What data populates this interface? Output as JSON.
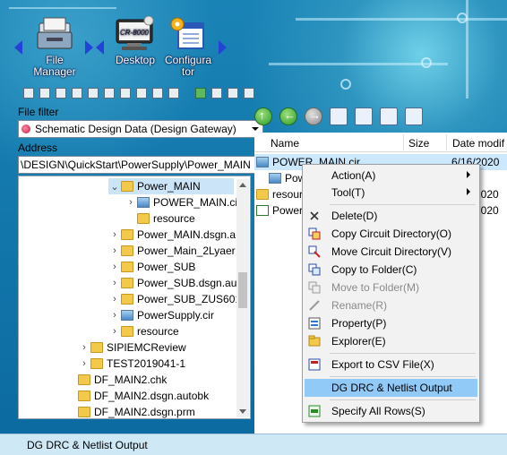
{
  "launcher": {
    "items": [
      {
        "label_line1": "File",
        "label_line2": "Manager",
        "icon": "file-manager-icon"
      },
      {
        "label_line1": "Desktop",
        "label_line2": "",
        "icon": "desktop-monitor-icon",
        "screen_text": "CR-8000"
      },
      {
        "label_line1": "Configura",
        "label_line2": "tor",
        "icon": "configurator-icon"
      }
    ]
  },
  "filter": {
    "label": "File filter",
    "selected": "Schematic Design Data (Design Gateway)"
  },
  "address": {
    "label": "Address",
    "value": "\\DESIGN\\QuickStart\\PowerSupply\\Power_MAIN"
  },
  "tree": {
    "items": [
      {
        "label": "Power_MAIN",
        "type": "folder",
        "expander": "⌄",
        "selected": true
      },
      {
        "label": "POWER_MAIN.cir",
        "type": "cir",
        "expander": "›"
      },
      {
        "label": "resource",
        "type": "folder",
        "expander": ""
      },
      {
        "label": "Power_MAIN.dsgn.a",
        "type": "folder",
        "expander": "›"
      },
      {
        "label": "Power_Main_2Lyaer",
        "type": "folder",
        "expander": "›"
      },
      {
        "label": "Power_SUB",
        "type": "folder",
        "expander": "›"
      },
      {
        "label": "Power_SUB.dsgn.au",
        "type": "folder",
        "expander": "›"
      },
      {
        "label": "Power_SUB_ZUS601",
        "type": "folder",
        "expander": "›"
      },
      {
        "label": "PowerSupply.cir",
        "type": "cir",
        "expander": "›"
      },
      {
        "label": "resource",
        "type": "folder",
        "expander": "›"
      },
      {
        "label": "SIPIEMCReview",
        "type": "folder",
        "expander": "›"
      },
      {
        "label": "TEST2019041-1",
        "type": "folder",
        "expander": "›"
      },
      {
        "label": "DF_MAIN2.chk",
        "type": "chk",
        "expander": ""
      },
      {
        "label": "DF_MAIN2.dsgn.autobk",
        "type": "folder",
        "expander": ""
      },
      {
        "label": "DF_MAIN2.dsgn.prm",
        "type": "prm",
        "expander": ""
      }
    ]
  },
  "file_list": {
    "columns": [
      "Name",
      "Size",
      "Date modif"
    ],
    "rows": [
      {
        "name": "POWER_MAIN.cir",
        "size": "",
        "date": "6/16/2020",
        "type": "cir",
        "selected": true
      },
      {
        "name": "Pow",
        "size": "",
        "date": "",
        "type": "cir",
        "selected": false
      },
      {
        "name": "resour",
        "size": "",
        "date": "2020",
        "type": "folder",
        "selected": false
      },
      {
        "name": "Power.",
        "size": "",
        "date": "2020",
        "type": "dg",
        "selected": false
      }
    ]
  },
  "context_menu": {
    "items": [
      {
        "label": "Action(A)",
        "icon": "",
        "submenu": true
      },
      {
        "label": "Tool(T)",
        "icon": "",
        "submenu": true
      },
      {
        "label": "Delete(D)",
        "icon": "delete-x-icon"
      },
      {
        "label": "Copy Circuit Directory(O)",
        "icon": "copy-circuit-icon"
      },
      {
        "label": "Move Circuit Directory(V)",
        "icon": "move-circuit-icon"
      },
      {
        "label": "Copy to Folder(C)",
        "icon": "copy-folder-icon"
      },
      {
        "label": "Move to Folder(M)",
        "icon": "move-folder-icon",
        "disabled": true
      },
      {
        "label": "Rename(R)",
        "icon": "rename-icon",
        "disabled": true
      },
      {
        "label": "Property(P)",
        "icon": "property-icon"
      },
      {
        "label": "Explorer(E)",
        "icon": "explorer-icon"
      },
      {
        "label": "Export to CSV File(X)",
        "icon": "export-csv-icon"
      },
      {
        "label": "DG DRC & Netlist Output",
        "icon": "",
        "highlight": true
      },
      {
        "label": "Specify All Rows(S)",
        "icon": "specify-rows-icon"
      }
    ]
  },
  "status_bar": {
    "text": "DG DRC & Netlist Output"
  }
}
